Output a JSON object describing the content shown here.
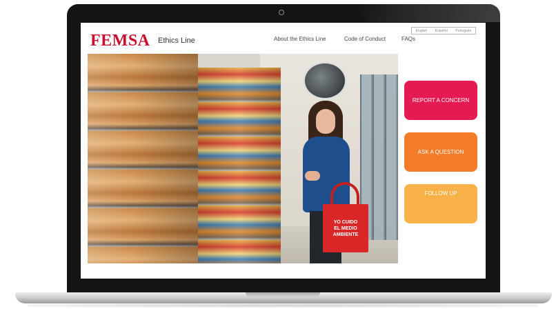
{
  "header": {
    "brand": "FEMSA",
    "brand_subtitle": "Ethics Line",
    "nav": [
      "About the Ethics Line",
      "Code of Conduct",
      "FAQs"
    ],
    "languages": [
      "English",
      "Español",
      "Português"
    ]
  },
  "hero": {
    "bag_text": [
      "YO CUIDO",
      "EL MEDIO",
      "AMBIENTE"
    ]
  },
  "actions": [
    {
      "label": "REPORT A CONCERN",
      "color": "#e61a52"
    },
    {
      "label": "ASK A QUESTION",
      "color": "#f47b29"
    },
    {
      "label": "FOLLOW UP",
      "color": "#f9b247"
    }
  ],
  "colors": {
    "brand_red": "#c8102e",
    "bezel": "#141414"
  }
}
